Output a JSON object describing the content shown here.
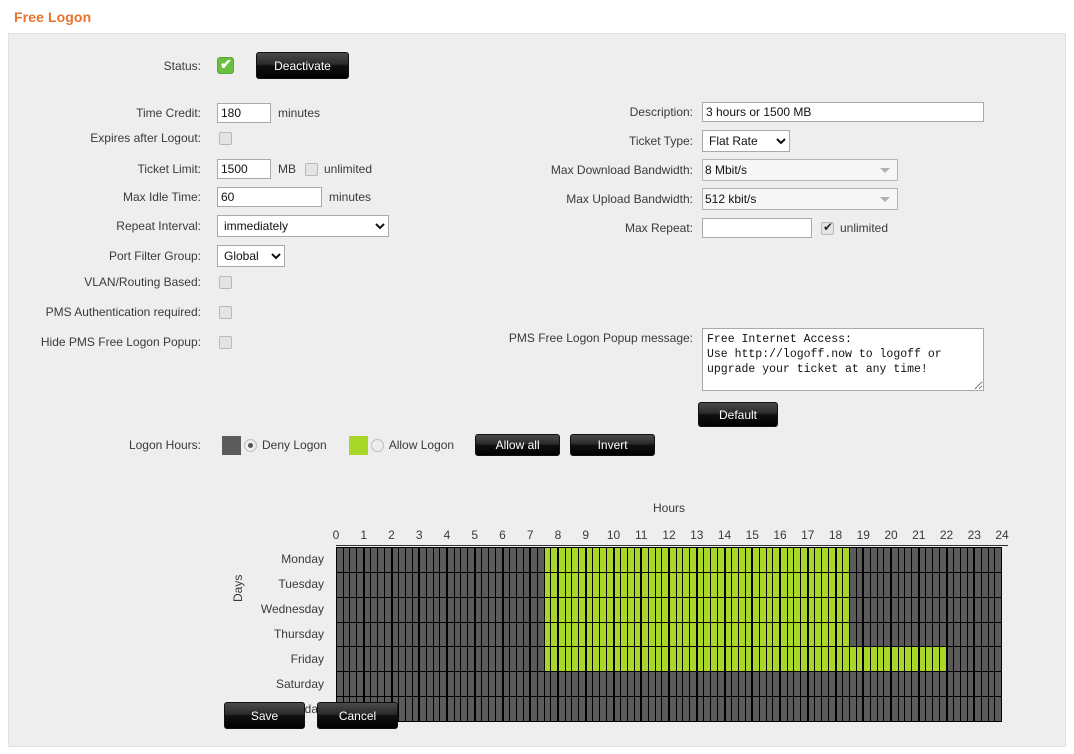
{
  "page": {
    "title": "Free Logon"
  },
  "status": {
    "label": "Status:",
    "checked": true,
    "toggle_button": "Deactivate"
  },
  "left_fields": {
    "time_credit": {
      "label": "Time Credit:",
      "value": "180",
      "unit": "minutes"
    },
    "expires_after_logout": {
      "label": "Expires after Logout:",
      "checked": false
    },
    "ticket_limit": {
      "label": "Ticket Limit:",
      "value": "1500",
      "unit": "MB",
      "unlimited_label": "unlimited",
      "unlimited_checked": false
    },
    "max_idle_time": {
      "label": "Max Idle Time:",
      "value": "60",
      "unit": "minutes"
    },
    "repeat_interval": {
      "label": "Repeat Interval:",
      "value": "immediately",
      "options": [
        "immediately"
      ]
    },
    "port_filter_group": {
      "label": "Port Filter Group:",
      "value": "Global",
      "options": [
        "Global"
      ]
    },
    "vlan_routing_based": {
      "label": "VLAN/Routing Based:",
      "checked": false
    },
    "pms_authentication_required": {
      "label": "PMS Authentication required:",
      "checked": false
    },
    "hide_pms_free_logon_popup": {
      "label": "Hide PMS Free Logon Popup:",
      "checked": false
    }
  },
  "right_fields": {
    "description": {
      "label": "Description:",
      "value": "3 hours or 1500 MB"
    },
    "ticket_type": {
      "label": "Ticket Type:",
      "value": "Flat Rate",
      "options": [
        "Flat Rate"
      ]
    },
    "max_download_bandwidth": {
      "label": "Max Download Bandwidth:",
      "value": "8 Mbit/s",
      "options": [
        "8 Mbit/s"
      ]
    },
    "max_upload_bandwidth": {
      "label": "Max Upload Bandwidth:",
      "value": "512 kbit/s",
      "options": [
        "512 kbit/s"
      ]
    },
    "max_repeat": {
      "label": "Max Repeat:",
      "value": "",
      "unlimited_label": "unlimited",
      "unlimited_checked": true
    },
    "pms_popup_message": {
      "label": "PMS Free Logon Popup message:",
      "value": "Free Internet Access:\nUse http://logoff.now to logoff or\nupgrade your ticket at any time!",
      "default_button": "Default"
    }
  },
  "logon_hours": {
    "label": "Logon Hours:",
    "deny_label": "Deny Logon",
    "allow_label": "Allow Logon",
    "selected_mode": "deny",
    "allow_all_button": "Allow all",
    "invert_button": "Invert",
    "hours_axis_title": "Hours",
    "days_axis_title": "Days",
    "hour_ticks": [
      "0",
      "1",
      "2",
      "3",
      "4",
      "5",
      "6",
      "7",
      "8",
      "9",
      "10",
      "11",
      "12",
      "13",
      "14",
      "15",
      "16",
      "17",
      "18",
      "19",
      "20",
      "21",
      "22",
      "23",
      "24"
    ],
    "days": [
      "Monday",
      "Tuesday",
      "Wednesday",
      "Thursday",
      "Friday",
      "Saturday",
      "Sunday"
    ],
    "slots_per_hour": 4,
    "allowed_ranges": {
      "Monday": [
        [
          7.5,
          18.5
        ]
      ],
      "Tuesday": [
        [
          7.5,
          18.5
        ]
      ],
      "Wednesday": [
        [
          7.5,
          18.5
        ]
      ],
      "Thursday": [
        [
          7.5,
          18.5
        ]
      ],
      "Friday": [
        [
          7.5,
          22.0
        ]
      ],
      "Saturday": [],
      "Sunday": []
    },
    "colors": {
      "deny": "#5b5b5b",
      "allow": "#a8d72a",
      "grid_line": "#000000"
    }
  },
  "footer": {
    "save_button": "Save",
    "cancel_button": "Cancel"
  },
  "theme": {
    "accent": "#e8722c",
    "panel_bg": "#eeeeee",
    "button_bg": "#111111",
    "allow_green": "#a8d72a",
    "status_green": "#6abf3f"
  }
}
